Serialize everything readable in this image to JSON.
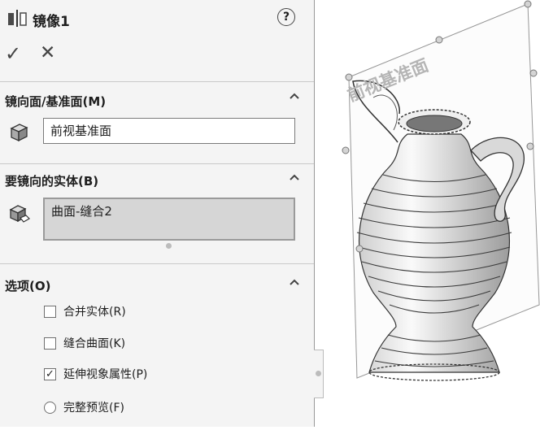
{
  "header": {
    "title": "镜像1",
    "help_label": "?",
    "ok_label": "✓",
    "cancel_label": "✕"
  },
  "mirror_face": {
    "section_title": "镜向面/基准面(M)",
    "value": "前视基准面"
  },
  "bodies": {
    "section_title": "要镜向的实体(B)",
    "value": "曲面-缝合2"
  },
  "options": {
    "section_title": "选项(O)",
    "items": [
      {
        "label": "合并实体(R)",
        "checked": false,
        "kind": "checkbox"
      },
      {
        "label": "缝合曲面(K)",
        "checked": false,
        "kind": "checkbox"
      },
      {
        "label": "延伸视象属性(P)",
        "checked": true,
        "kind": "checkbox"
      },
      {
        "label": "完整预览(F)",
        "checked": false,
        "kind": "radio"
      }
    ]
  },
  "viewport": {
    "plane_label": "前视基准面"
  },
  "icons": [
    "mirror-feature-icon",
    "help-icon",
    "plane-cube-icon",
    "solid-body-icon",
    "chevron-up-icon"
  ]
}
